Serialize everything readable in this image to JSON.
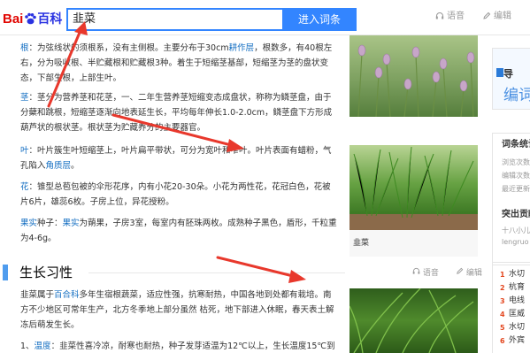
{
  "header": {
    "logo_bai": "Bai",
    "logo_du": "du",
    "logo_baike": "百科",
    "search_value": "韭菜",
    "search_button": "进入词条",
    "voice_label": "语音",
    "edit_label": "编辑"
  },
  "article": {
    "p_root": {
      "term": "根",
      "text1": "：为弦线状的须根系，没有主侧根。主要分布于30cm",
      "link1": "耕作层",
      "text2": "，根数多，有40根左右，分为吸收根、半贮藏根和贮藏根3种。着生于短缩茎基部，短缩茎为茎的盘状变态，下部生根，上部生叶。"
    },
    "p_stem": {
      "term": "茎",
      "text": "：茎分为营养茎和花茎，一、二年生营养茎短缩变态成盘状，称称为鳞茎盘，由于分蘖和跳根，短缩茎逐渐向地表延生长，平均每年伸长1.0-2.0cm，鳞茎盘下方形成葫芦状的根状茎。根状茎为贮藏养分的主要器官。"
    },
    "p_leaf": {
      "term": "叶",
      "text1": "：叶片簇生叶短缩茎上，叶片扁平带状，可分为宽叶和窄叶。叶片表面有蜡粉，气孔陷入",
      "link1": "角质层",
      "text2": "。"
    },
    "p_flower": {
      "term": "花",
      "text": "：锥型总苞包被的伞形花序，内有小花20-30朵。小花为两性花，花冠白色，花被片6片，雄蕊6枚。子房上位，异花授粉。"
    },
    "p_fruit": {
      "term": "果实",
      "mid": "种子：",
      "term2": "果实",
      "text": "为蒴果，子房3室，每室内有胚珠两枚。成熟种子黑色，盾形，千粒重为4-6g。"
    },
    "section_title": "生长习性",
    "section_voice": "语音",
    "section_edit": "编辑",
    "p_habit": {
      "text1": "韭菜属于",
      "link1": "百合科",
      "text2": "多年生宿根蔬菜，适应性强，抗寒耐热，中国各地到处都有栽培。南方不少地区可常年生产，北方冬季地上部分虽然 枯死，地下部进入休眠，春天表土解冻后萌发生长。"
    },
    "p_temp": {
      "num": "1、",
      "term": "温度",
      "text": "：韭菜性喜冷凉，耐寒也耐热，种子发芽适温为12℃以上，生长温度15℃到"
    }
  },
  "images": {
    "caption2": "韭菜"
  },
  "sidebar": {
    "card_title": "导",
    "card_sub": "编词",
    "stats_title": "词条统计",
    "stats_lines": [
      "浏览次数",
      "编辑次数",
      "最近更新"
    ],
    "highlight_title": "突出贡献",
    "highlight_lines": [
      "十八小儿",
      "lengruo"
    ],
    "rank": [
      {
        "num": "1",
        "label": "水切"
      },
      {
        "num": "2",
        "label": "杭育"
      },
      {
        "num": "3",
        "label": "电线"
      },
      {
        "num": "4",
        "label": "匡威"
      },
      {
        "num": "5",
        "label": "水切"
      },
      {
        "num": "6",
        "label": "外宾"
      }
    ]
  },
  "colors": {
    "brand_blue": "#3385ff",
    "link_blue": "#136ec2",
    "arrow_red": "#e8382c",
    "section_bar": "#4f9cee"
  }
}
